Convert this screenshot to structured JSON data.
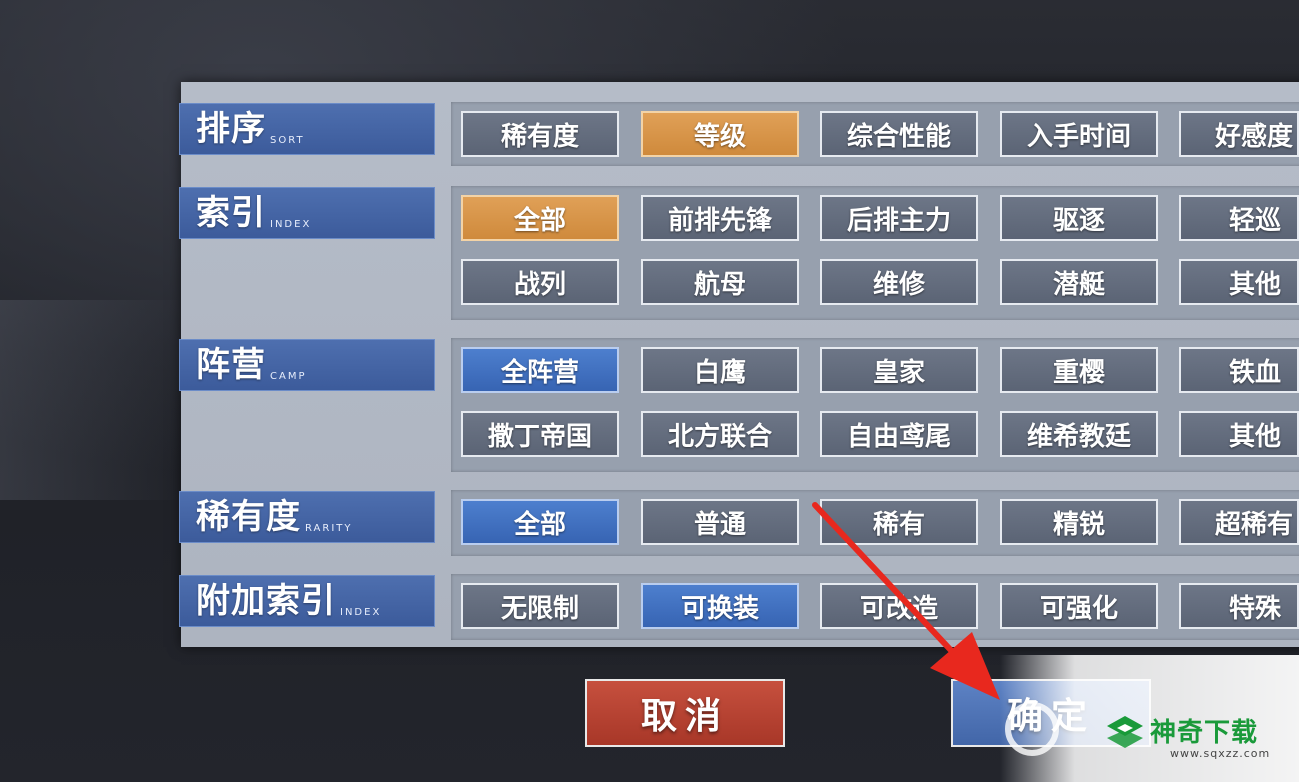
{
  "filters": {
    "sort": {
      "label": "排序",
      "label_en": "SORT",
      "options": [
        "稀有度",
        "等级",
        "综合性能",
        "入手时间",
        "好感度"
      ],
      "selected": "等级"
    },
    "index": {
      "label": "索引",
      "label_en": "INDEX",
      "options": [
        "全部",
        "前排先锋",
        "后排主力",
        "驱逐",
        "轻巡",
        "战列",
        "航母",
        "维修",
        "潜艇",
        "其他"
      ],
      "selected": "全部"
    },
    "camp": {
      "label": "阵营",
      "label_en": "CAMP",
      "options": [
        "全阵营",
        "白鹰",
        "皇家",
        "重樱",
        "铁血",
        "撒丁帝国",
        "北方联合",
        "自由鸢尾",
        "维希教廷",
        "其他"
      ],
      "selected": "全阵营"
    },
    "rarity": {
      "label": "稀有度",
      "label_en": "RARITY",
      "options": [
        "全部",
        "普通",
        "稀有",
        "精锐",
        "超稀有"
      ],
      "selected": "全部"
    },
    "extra": {
      "label": "附加索引",
      "label_en": "INDEX",
      "options": [
        "无限制",
        "可换装",
        "可改造",
        "可强化",
        "特殊"
      ],
      "selected": "可换装"
    }
  },
  "buttons": {
    "cancel": "取消",
    "confirm": "确定"
  },
  "watermark": {
    "title": "神奇下载",
    "url": "www.sqxzz.com"
  },
  "colors": {
    "selected_orange": "#d6914a",
    "selected_blue": "#4170c0",
    "label_blue": "#4565a5",
    "cancel_red": "#b6402f",
    "arrow_red": "#e8281e"
  }
}
